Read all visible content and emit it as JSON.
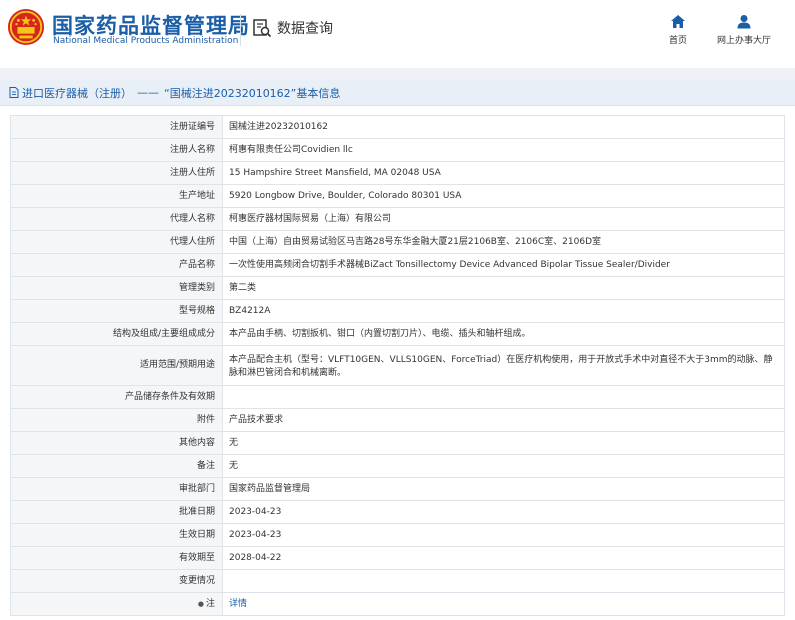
{
  "header": {
    "brand_cn": "国家药品监督管理局",
    "brand_en": "National Medical Products Administration",
    "search_tool_label": "数据查询",
    "nav": [
      {
        "label": "首页",
        "icon": "home-icon"
      },
      {
        "label": "网上办事大厅",
        "icon": "user-icon"
      }
    ]
  },
  "title_bar": {
    "category": "进口医疗器械（注册）",
    "separator": "——",
    "record_title": "“国械注进20232010162”基本信息"
  },
  "table": {
    "rows": [
      {
        "label": "注册证编号",
        "value": "国械注进20232010162"
      },
      {
        "label": "注册人名称",
        "value": "柯惠有限责任公司Covidien llc"
      },
      {
        "label": "注册人住所",
        "value": "15 Hampshire Street Mansfield, MA 02048 USA"
      },
      {
        "label": "生产地址",
        "value": "5920 Longbow Drive, Boulder, Colorado 80301 USA"
      },
      {
        "label": "代理人名称",
        "value": "柯惠医疗器材国际贸易（上海）有限公司"
      },
      {
        "label": "代理人住所",
        "value": "中国（上海）自由贸易试验区马吉路28号东华金融大厦21层2106B室、2106C室、2106D室"
      },
      {
        "label": "产品名称",
        "value": "一次性使用高频闭合切割手术器械BiZact Tonsillectomy Device Advanced Bipolar Tissue Sealer/Divider"
      },
      {
        "label": "管理类别",
        "value": "第二类"
      },
      {
        "label": "型号规格",
        "value": "BZ4212A"
      },
      {
        "label": "结构及组成/主要组成成分",
        "value": "本产品由手柄、切割扳机、钳口（内置切割刀片）、电缆、插头和轴杆组成。"
      },
      {
        "label": "适用范围/预期用途",
        "value": "本产品配合主机（型号：VLFT10GEN、VLLS10GEN、ForceTriad）在医疗机构使用，用于开放式手术中对直径不大于3mm的动脉、静脉和淋巴管闭合和机械离断。",
        "tall": true
      },
      {
        "label": "产品储存条件及有效期",
        "value": ""
      },
      {
        "label": "附件",
        "value": "产品技术要求"
      },
      {
        "label": "其他内容",
        "value": "无"
      },
      {
        "label": "备注",
        "value": "无"
      },
      {
        "label": "审批部门",
        "value": "国家药品监督管理局"
      },
      {
        "label": "批准日期",
        "value": "2023-04-23"
      },
      {
        "label": "生效日期",
        "value": "2023-04-23"
      },
      {
        "label": "有效期至",
        "value": "2028-04-22"
      },
      {
        "label": "变更情况",
        "value": ""
      }
    ],
    "note": {
      "label": "注",
      "value": "详情"
    }
  },
  "colors": {
    "brand_blue": "#1b5ea8",
    "label_bg": "#f4f6f8",
    "title_bar_bg": "#e9eff6",
    "emblem_red": "#d7261e",
    "emblem_gold": "#f5c518"
  }
}
